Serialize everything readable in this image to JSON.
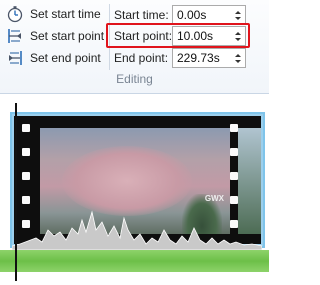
{
  "ribbon": {
    "commands": [
      {
        "label": "Set start time",
        "icon": "stopwatch-icon"
      },
      {
        "label": "Set start point",
        "icon": "set-start-point-icon"
      },
      {
        "label": "Set end point",
        "icon": "set-end-point-icon"
      }
    ],
    "fields": [
      {
        "label": "Start time:",
        "value": "0.00s"
      },
      {
        "label": "Start point:",
        "value": "10.00s"
      },
      {
        "label": "End point:",
        "value": "229.73s"
      }
    ],
    "group_label": "Editing",
    "highlight_color": "#e0141c"
  },
  "timeline": {
    "clip_border_color": "#7fc4ea",
    "audio_color": "#6dbf48",
    "thumbnail_watermark": "GWX"
  }
}
